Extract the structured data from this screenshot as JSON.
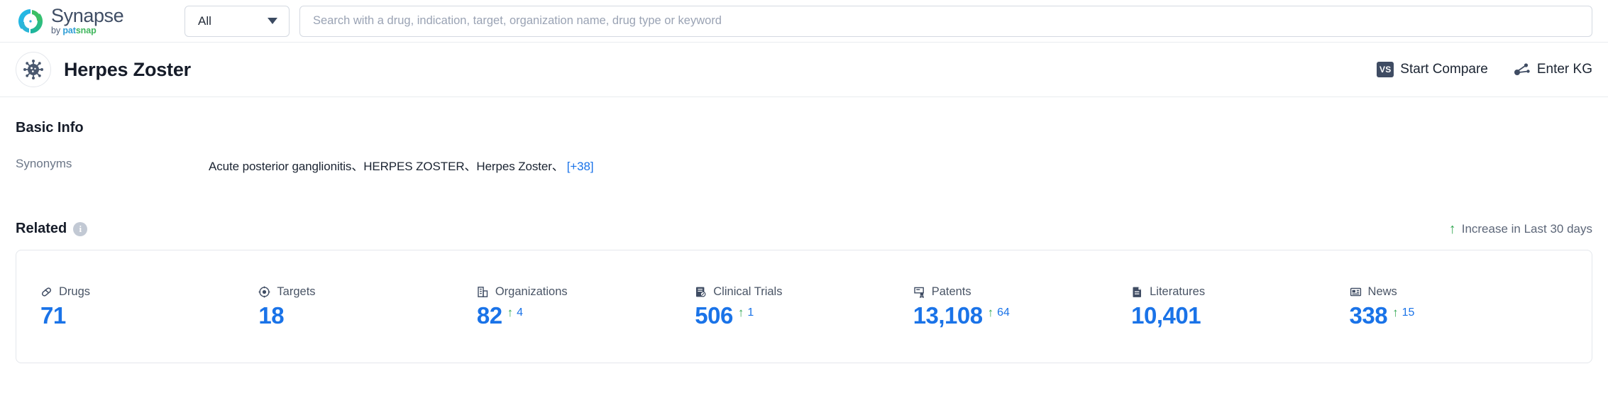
{
  "header": {
    "logo": {
      "name": "Synapse",
      "by": "by ",
      "brand_pat": "pat",
      "brand_snap": "snap",
      "icon": "synapse-logo-icon"
    },
    "scope": {
      "selected": "All",
      "options": [
        "All"
      ],
      "icon": "chevron-down-icon"
    },
    "search": {
      "value": "",
      "placeholder": "Search with a drug, indication, target, organization name, drug type or keyword",
      "icon": "search-input"
    }
  },
  "entity": {
    "avatar_icon": "virus-icon",
    "title": "Herpes Zoster",
    "actions": [
      {
        "label": "Start Compare",
        "icon": "vs-badge-icon",
        "badge": "VS"
      },
      {
        "label": "Enter KG",
        "icon": "knowledge-graph-icon"
      }
    ]
  },
  "basic_info": {
    "heading": "Basic Info",
    "rows": [
      {
        "label": "Synonyms",
        "value": "Acute posterior ganglionitis、HERPES ZOSTER、Herpes Zoster、",
        "more": "[+38]"
      }
    ]
  },
  "related": {
    "title": "Related",
    "info_icon": "info-icon",
    "info_glyph": "i",
    "legend": {
      "arrow": "↑",
      "text": "Increase in Last 30 days"
    },
    "stats": [
      {
        "label": "Drugs",
        "icon": "pill-icon",
        "value": "71",
        "delta": "",
        "delta_arrow": ""
      },
      {
        "label": "Targets",
        "icon": "target-icon",
        "value": "18",
        "delta": "",
        "delta_arrow": ""
      },
      {
        "label": "Organizations",
        "icon": "organization-icon",
        "value": "82",
        "delta": "4",
        "delta_arrow": "↑"
      },
      {
        "label": "Clinical Trials",
        "icon": "clinical-trial-icon",
        "value": "506",
        "delta": "1",
        "delta_arrow": "↑"
      },
      {
        "label": "Patents",
        "icon": "patent-icon",
        "value": "13,108",
        "delta": "64",
        "delta_arrow": "↑"
      },
      {
        "label": "Literatures",
        "icon": "literature-icon",
        "value": "10,401",
        "delta": "",
        "delta_arrow": ""
      },
      {
        "label": "News",
        "icon": "news-icon",
        "value": "338",
        "delta": "15",
        "delta_arrow": "↑"
      }
    ]
  },
  "colors": {
    "accent_blue": "#1a73e8",
    "increase_green": "#34a853",
    "text_dark": "#161c29",
    "text_muted": "#6b7687",
    "border": "#e4e7ec"
  }
}
